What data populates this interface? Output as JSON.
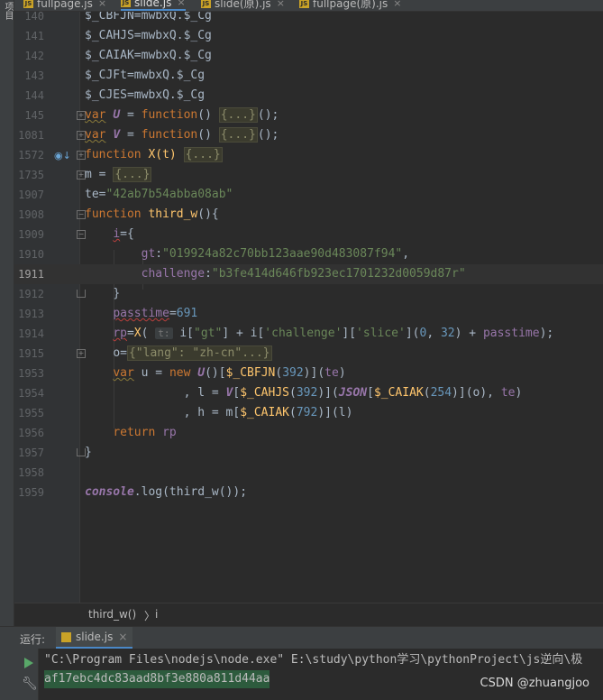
{
  "tool_stripe": {
    "label": "项目"
  },
  "tabs": [
    {
      "label": "fullpage.js",
      "active": false
    },
    {
      "label": "slide.js",
      "active": true
    },
    {
      "label": "slide(原).js",
      "active": false
    },
    {
      "label": "fullpage(原).js",
      "active": false
    }
  ],
  "tab_close": "×",
  "editor": {
    "line_numbers": [
      "140",
      "141",
      "142",
      "143",
      "144",
      "145",
      "1081",
      "1572",
      "1735",
      "1907",
      "1908",
      "1909",
      "1910",
      "1911",
      "1912",
      "1913",
      "1914",
      "1915",
      "1953",
      "1954",
      "1955",
      "1956",
      "1957",
      "1958",
      "1959"
    ],
    "current_line": "1911",
    "code": {
      "l140": "$_CBFJN=mwbxQ.$_Cg",
      "l141": "$_CAHJS=mwbxQ.$_Cg",
      "l142": "$_CAIAK=mwbxQ.$_Cg",
      "l143": "$_CJFt=mwbxQ.$_Cg",
      "l144": "$_CJES=mwbxQ.$_Cg",
      "l145_var": "var",
      "l145_name": "U",
      "l1081_name": "V",
      "assign_eq": " = ",
      "function_kw": "function",
      "func_paren": "() ",
      "collapsed_block": "{...}",
      "iife_tail": "();",
      "l1572_sig": " X(t) ",
      "l1735_m": "m = ",
      "l1907_te": "te=",
      "l1907_value": "\"42ab7b54abba08ab\"",
      "l1908_name": "third_w",
      "l1908_tail": "(){",
      "l1909_i": "i",
      "l1909_tail": "={",
      "gt_key": "gt",
      "gt_value": "\"019924a82c70bb123aae90d483087f94\"",
      "challenge_key": "challenge",
      "challenge_value": "\"b3fe414d646fb923ec1701232d0059d87r\"",
      "close_brace": "}",
      "passtime_name": "passtime",
      "passtime_value": "691",
      "rp_name": "rp",
      "rp_fn": "X",
      "param_hint": "t:",
      "rp_expr_a": " i[",
      "rp_str_gt": "\"gt\"",
      "rp_expr_b": "] + i[",
      "rp_str_challenge": "'challenge'",
      "rp_expr_c": "][",
      "rp_str_slice": "'slice'",
      "rp_expr_d": "](",
      "rp_num_0": "0",
      "rp_comma": ", ",
      "rp_num_32": "32",
      "rp_expr_e": ") + ",
      "rp_passtime": "passtime",
      "rp_end": ");",
      "o_name": "o=",
      "o_collapsed": "{\"lang\": \"zh-cn\"...}",
      "l1953_u": "u",
      "l1953_new": "new",
      "l1953_U": "U",
      "l1953_a": "()[",
      "l1953_var": "$_CBFJN",
      "l1953_b": "(",
      "l1953_num": "392",
      "l1953_c": ")](",
      "l1953_te": "te",
      "l1953_d": ")",
      "l1954_a": ", l = ",
      "l1954_V": "V",
      "l1954_b": "[",
      "l1954_var": "$_CAHJS",
      "l1954_num": "392",
      "l1954_c": ")](",
      "l1954_json": "JSON",
      "l1954_var2": "$_CAIAK",
      "l1954_num2": "254",
      "l1954_d": ")](o), ",
      "l1954_te": "te",
      "l1955_a": ", h = m[",
      "l1955_var": "$_CAIAK",
      "l1955_num": "792",
      "l1955_b": ")](l)",
      "return_kw": "return",
      "return_val": " rp",
      "console_obj": "console",
      "console_rest": ".log(third_w());"
    }
  },
  "breadcrumb": {
    "func": "third_w()",
    "sep": "〉",
    "var": "i"
  },
  "run_panel": {
    "label": "运行:",
    "tab": "slide.js",
    "command": "\"C:\\Program Files\\nodejs\\node.exe\" E:\\study\\python学习\\pythonProject\\js逆向\\极",
    "output": "af17ebc4dc83aad8bf3e880a811d44aa"
  },
  "watermark": "CSDN @zhuangjoo",
  "colors": {
    "keyword": "#cc7832",
    "string": "#6a8759",
    "number": "#6897bb",
    "function": "#ffc66d",
    "global_var": "#9876aa",
    "background": "#2b2b2b",
    "run_green": "#59a869"
  }
}
